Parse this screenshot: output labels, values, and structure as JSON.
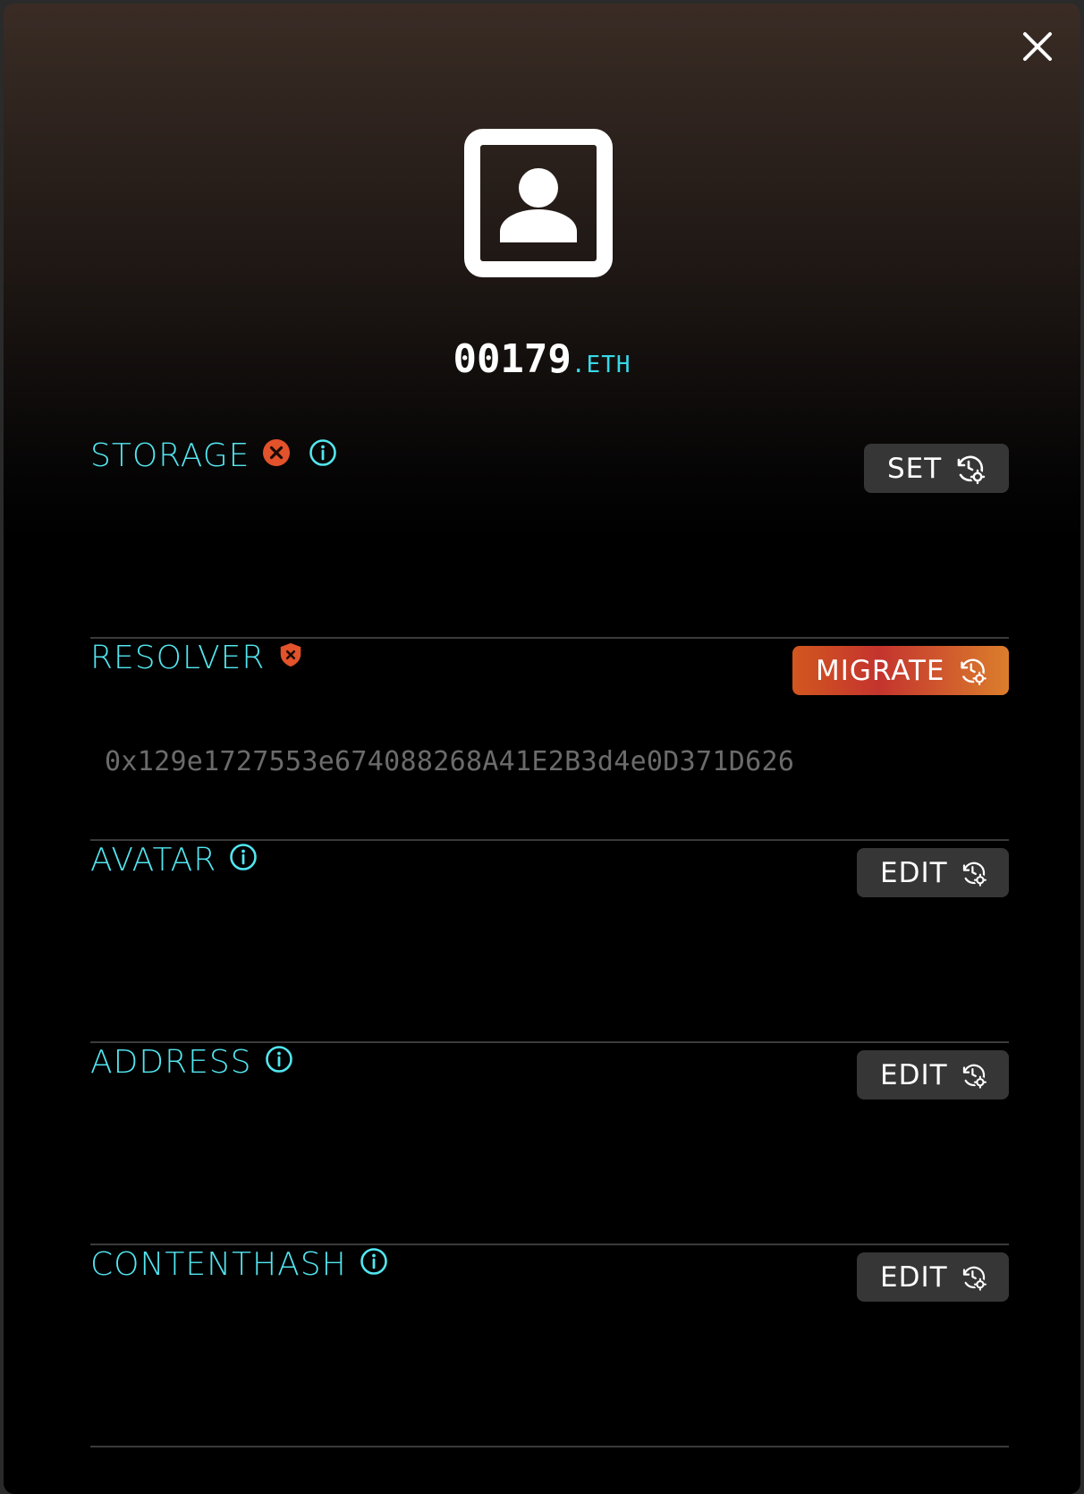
{
  "name": {
    "label": "00179",
    "tld": ".ETH"
  },
  "icons": {
    "close": "close-icon",
    "avatar_placeholder": "user-portrait-icon",
    "info": "info-icon",
    "error": "error-x-circle-icon",
    "shield_error": "shield-x-icon",
    "history_settings": "history-gear-icon"
  },
  "colors": {
    "accent_cyan": "#52e6f0",
    "error_red": "#e2522b",
    "migrate_gradient_start": "#d2571f",
    "migrate_gradient_end": "#db7e2c",
    "button_bg": "#363636"
  },
  "sections": {
    "storage": {
      "label": "STORAGE",
      "button": "SET"
    },
    "resolver": {
      "label": "RESOLVER",
      "button": "MIGRATE",
      "value": "0x129e1727553e674088268A41E2B3d4e0D371D626"
    },
    "avatar": {
      "label": "AVATAR",
      "button": "EDIT"
    },
    "address": {
      "label": "ADDRESS",
      "button": "EDIT"
    },
    "contenthash": {
      "label": "CONTENTHASH",
      "button": "EDIT"
    }
  }
}
